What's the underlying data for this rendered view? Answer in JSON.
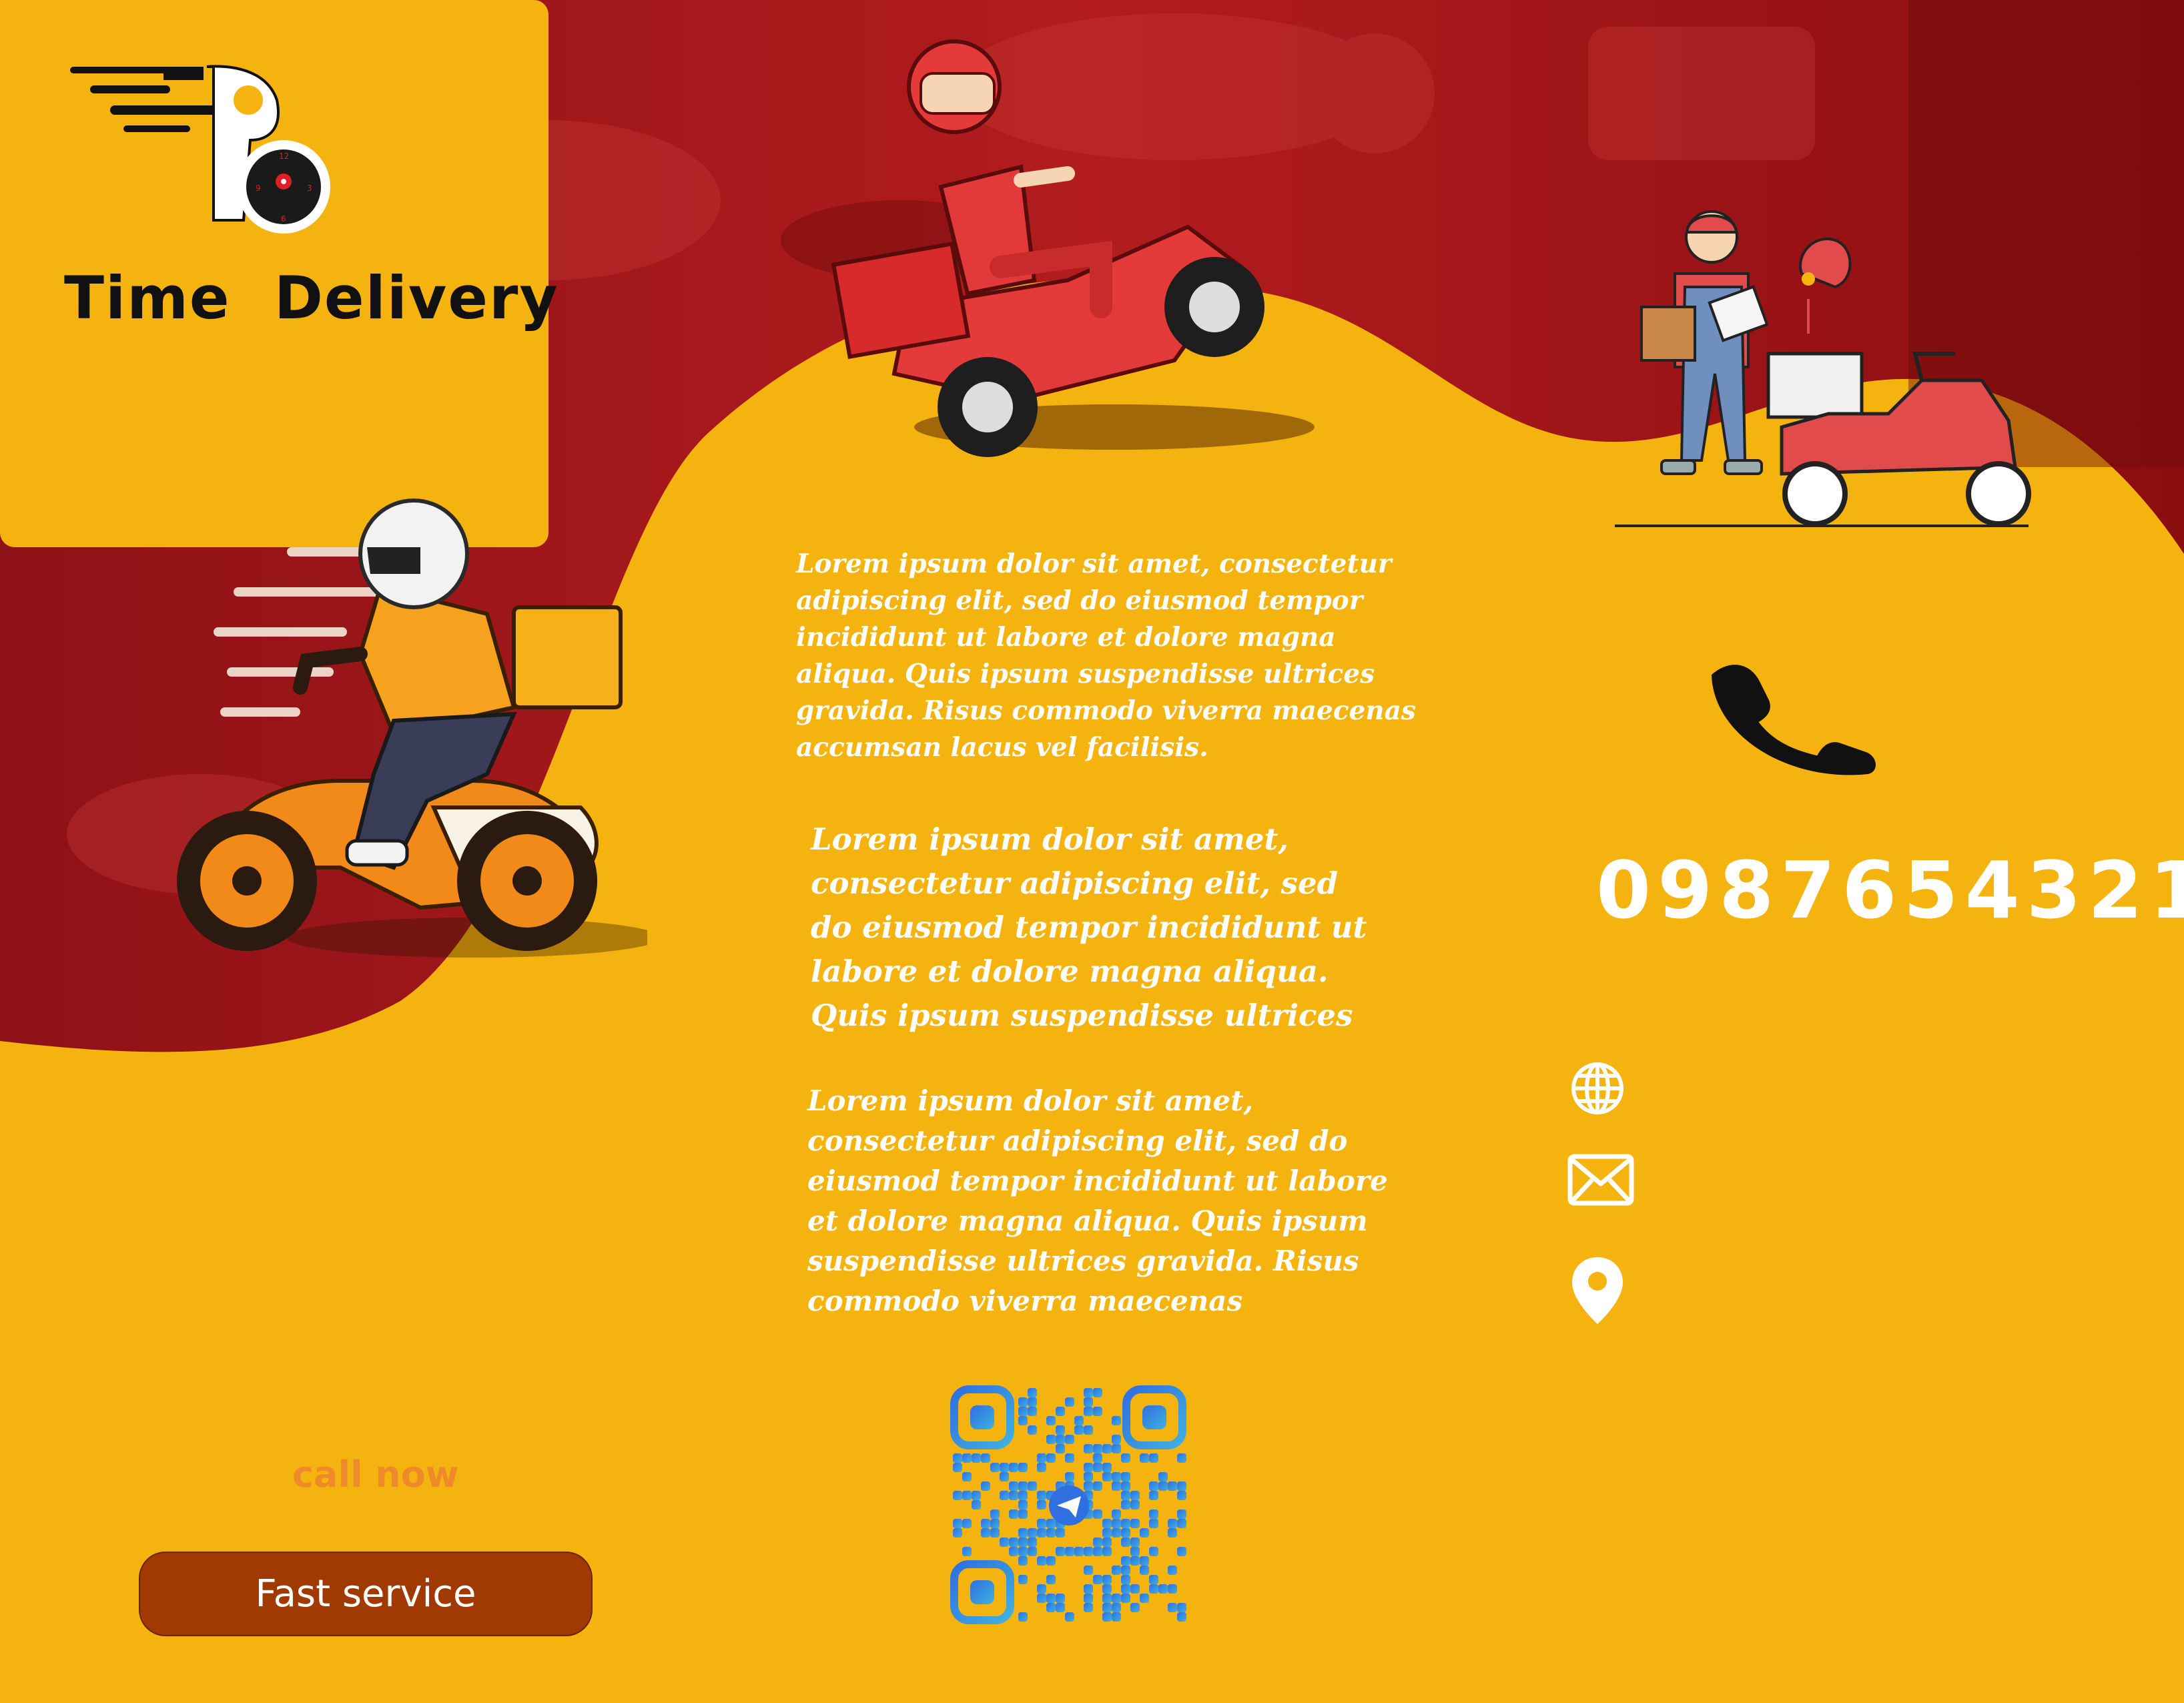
{
  "brand": {
    "name": "Time  Delivery"
  },
  "texts": {
    "paragraph_1": "Lorem ipsum dolor sit amet, consectetur\nadipiscing elit, sed do eiusmod tempor\nincididunt ut labore et dolore magna\naliqua. Quis ipsum suspendisse ultrices\ngravida. Risus commodo viverra maecenas\naccumsan lacus vel facilisis.",
    "paragraph_2": "Lorem ipsum dolor sit amet,\nconsectetur adipiscing elit, sed\ndo eiusmod tempor incididunt ut\nlabore et dolore magna aliqua.\nQuis ipsum suspendisse ultrices",
    "paragraph_3": "Lorem ipsum dolor sit amet,\nconsectetur adipiscing elit, sed do\neiusmod tempor incididunt ut labore\net dolore magna aliqua. Quis ipsum\nsuspendisse ultrices gravida. Risus\ncommodo viverra maecenas"
  },
  "contact": {
    "phone": "0987654321"
  },
  "cta": {
    "call_now": "call now",
    "fast_service": "Fast service"
  },
  "icons": [
    "delivery-logo-icon",
    "phone-icon",
    "globe-icon",
    "mail-icon",
    "location-pin-icon",
    "qr-code-icon"
  ],
  "colors": {
    "yellow": "#f5b30f",
    "red": "#a3151a",
    "dark_red": "#7d0b0e",
    "button": "#a13a02",
    "call_now": "#ef8a2b",
    "qr_blue": "#3a7fd6"
  }
}
